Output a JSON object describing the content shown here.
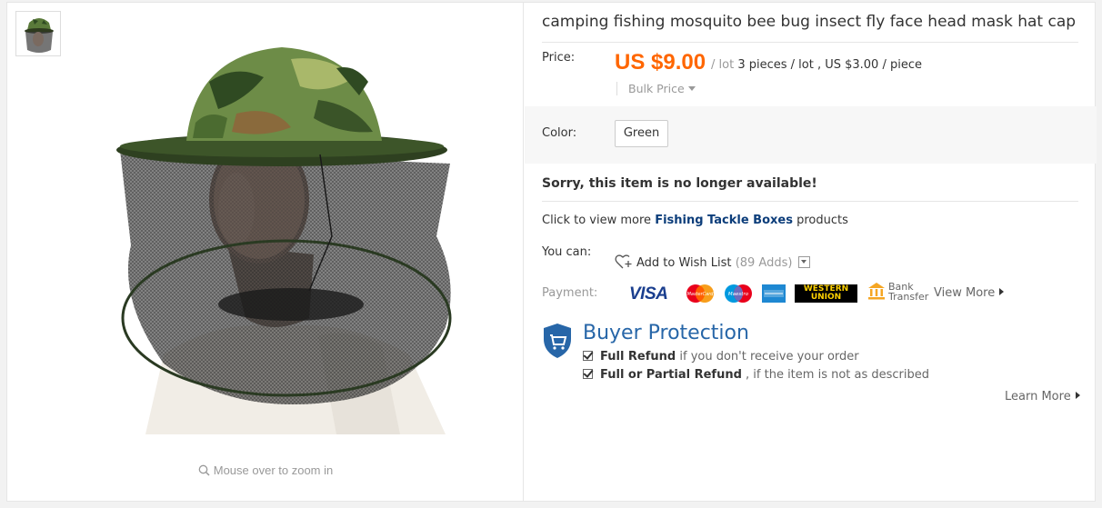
{
  "gallery": {
    "thumbnail_alt": "product thumbnail",
    "zoom_hint": "Mouse over to zoom in"
  },
  "product": {
    "title": "camping fishing mosquito bee bug insect fly face head mask hat cap",
    "price_label": "Price:",
    "price": "US $9.00",
    "price_unit": "/ lot",
    "price_detail": "3 pieces / lot , US $3.00 / piece",
    "bulk_price": "Bulk Price",
    "color_label": "Color:",
    "color_value": "Green",
    "unavailable": "Sorry, this item is no longer available!",
    "view_more_prefix": "Click to view more",
    "view_more_category": "Fishing Tackle Boxes",
    "view_more_suffix": "products",
    "you_can_label": "You can:",
    "wish_list": "Add to Wish List",
    "wish_adds": "(89 Adds)"
  },
  "payment": {
    "label": "Payment:",
    "methods": [
      "VISA",
      "MasterCard",
      "Maestro",
      "American Express",
      "Western Union",
      "Bank Transfer"
    ],
    "visa_text": "VISA",
    "mastercard_text": "MasterCard",
    "maestro_text": "Maestro",
    "wu_line1": "WESTERN",
    "wu_line2": "UNION",
    "bank_line1": "Bank",
    "bank_line2": "Transfer",
    "view_more": "View More"
  },
  "protection": {
    "title": "Buyer Protection",
    "item1_bold": "Full Refund",
    "item1_rest": " if you don't receive your order",
    "item2_bold": "Full or Partial Refund",
    "item2_rest": " , if the item is not as described",
    "learn_more": "Learn More"
  },
  "colors": {
    "price": "#ff6600",
    "link": "#0c3d7a",
    "protection": "#2766a8"
  }
}
